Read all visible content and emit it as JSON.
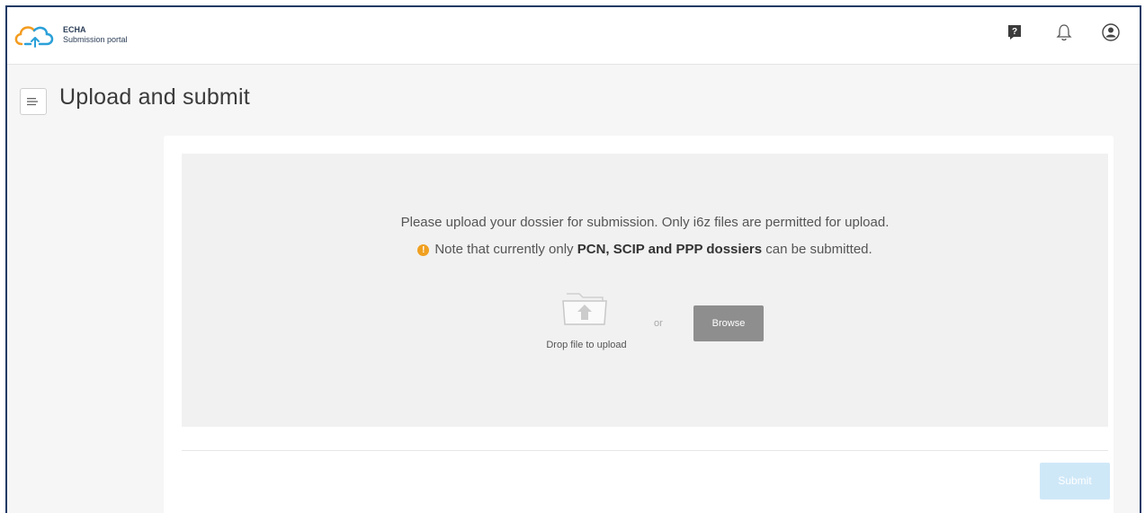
{
  "header": {
    "logo_line1": "ECHA",
    "logo_line2": "Submission portal",
    "icons": [
      "feedback-icon",
      "bell-icon",
      "user-icon"
    ]
  },
  "page": {
    "title": "Upload and submit"
  },
  "upload": {
    "instruction": "Please upload your dossier for submission. Only i6z files are permitted for upload.",
    "note_prefix": "Note that currently only ",
    "note_bold": "PCN, SCIP and PPP dossiers",
    "note_suffix": " can be submitted.",
    "drop_label": "Drop file to upload",
    "or_label": "or",
    "browse_label": "Browse"
  },
  "footer": {
    "submit_label": "Submit"
  },
  "colors": {
    "frame_border": "#1f3a66",
    "warning": "#f0a020",
    "browse_bg": "#8e8e8e",
    "submit_disabled_bg": "#cfe8f8",
    "logo_orange": "#f39c1f",
    "logo_blue": "#2aa0d8"
  }
}
